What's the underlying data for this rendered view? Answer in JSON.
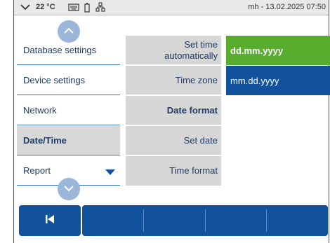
{
  "status_bar": {
    "temperature": "22 °C",
    "right_text": "mh - 13.02.2025 07:50"
  },
  "menu": {
    "items": [
      {
        "label": "Database settings",
        "active": false
      },
      {
        "label": "Device settings",
        "active": false
      },
      {
        "label": "Network",
        "active": false
      },
      {
        "label": "Date/Time",
        "active": true
      },
      {
        "label": "Report",
        "active": false
      }
    ]
  },
  "settings": {
    "items": [
      {
        "label": "Set time automatically",
        "bold": false
      },
      {
        "label": "Time zone",
        "bold": false
      },
      {
        "label": "Date format",
        "bold": true
      },
      {
        "label": "Set date",
        "bold": false
      },
      {
        "label": "Time format",
        "bold": false
      }
    ]
  },
  "options": {
    "items": [
      {
        "label": "dd.mm.yyyy",
        "selected": true
      },
      {
        "label": "mm.dd.yyyy",
        "selected": false
      }
    ]
  },
  "icons": {
    "status_left": "chevron-down-icon",
    "keyboard": "keyboard-icon",
    "battery": "battery-icon",
    "network": "network-icon",
    "scroll_up": "chevron-up-icon",
    "scroll_down": "chevron-down-icon",
    "back": "skip-back-icon",
    "submenu": "triangle-down-icon"
  },
  "colors": {
    "primary": "#12529c",
    "selected": "#58ac2e",
    "panel": "#d6d6d6",
    "active_item": "#d8d8d8",
    "text": "#1f3b66"
  }
}
